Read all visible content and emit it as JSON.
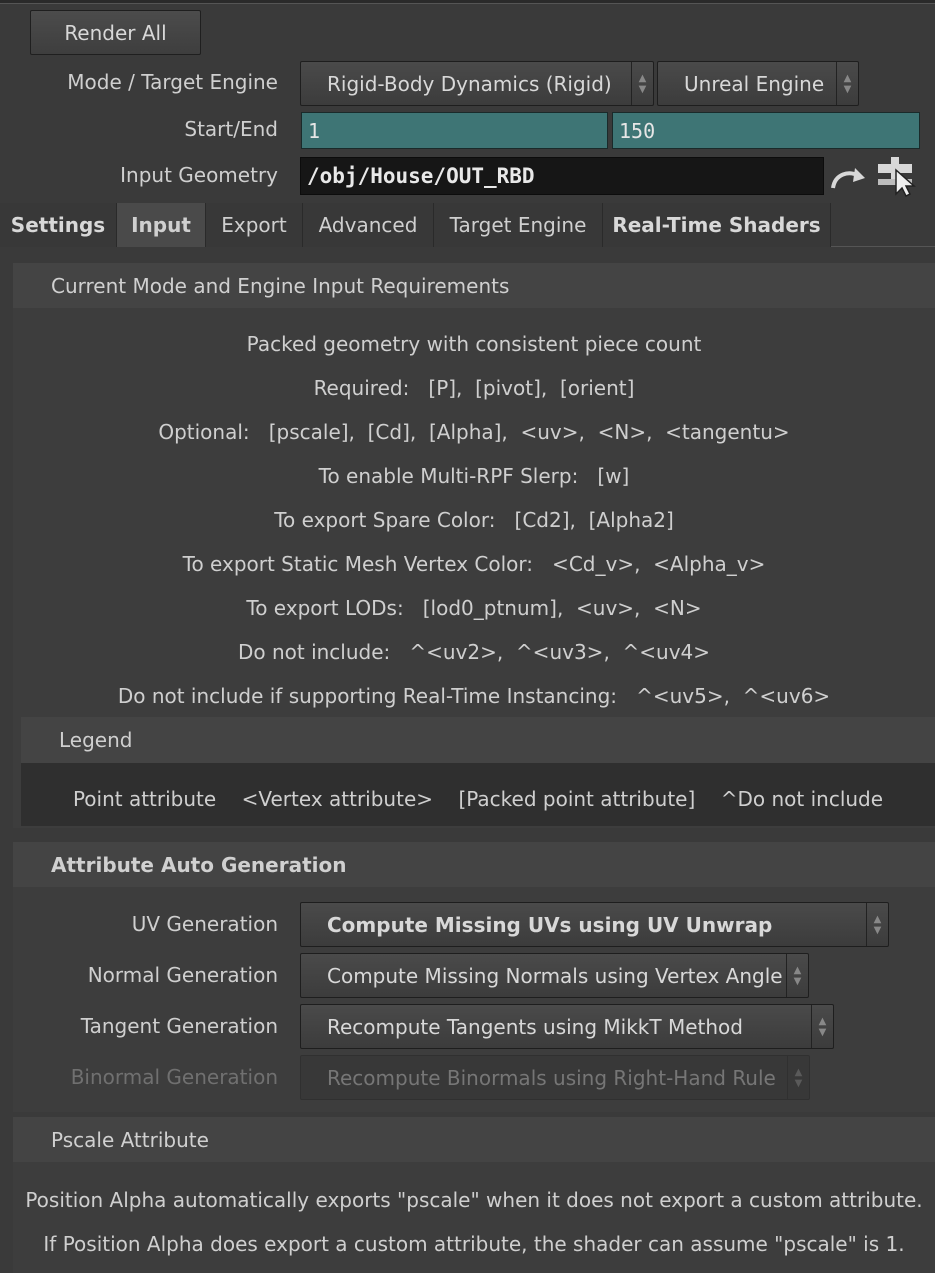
{
  "toolbar": {
    "render_all_label": "Render All"
  },
  "mode_row": {
    "label": "Mode / Target Engine",
    "mode_value": "Rigid-Body Dynamics (Rigid)",
    "engine_value": "Unreal Engine"
  },
  "range_row": {
    "label": "Start/End",
    "start": "1",
    "end": "150"
  },
  "geometry_row": {
    "label": "Input Geometry",
    "path": "/obj/House/OUT_RBD"
  },
  "tabs": [
    {
      "label": "Settings"
    },
    {
      "label": "Input"
    },
    {
      "label": "Export"
    },
    {
      "label": "Advanced"
    },
    {
      "label": "Target Engine"
    },
    {
      "label": "Real-Time Shaders"
    }
  ],
  "requirements": {
    "title": "Current Mode and Engine Input Requirements",
    "lines": [
      "Packed geometry with consistent piece count",
      "Required:   [P],  [pivot],  [orient]",
      "Optional:   [pscale],  [Cd],  [Alpha],  <uv>,  <N>,  <tangentu>",
      "To enable Multi-RPF Slerp:   [w]",
      "To export Spare Color:   [Cd2],  [Alpha2]",
      "To export Static Mesh Vertex Color:   <Cd_v>,  <Alpha_v>",
      "To export LODs:   [lod0_ptnum],  <uv>,  <N>",
      "Do not include:   ^<uv2>,  ^<uv3>,  ^<uv4>",
      "Do not include if supporting Real-Time Instancing:   ^<uv5>,  ^<uv6>"
    ]
  },
  "legend": {
    "title": "Legend",
    "text": "Point attribute    <Vertex attribute>    [Packed point attribute]    ^Do not include"
  },
  "auto_gen": {
    "title": "Attribute Auto Generation",
    "uv_label": "UV Generation",
    "uv_value": "Compute Missing UVs using UV Unwrap",
    "normal_label": "Normal Generation",
    "normal_value": "Compute Missing Normals using Vertex Angle",
    "tangent_label": "Tangent Generation",
    "tangent_value": "Recompute Tangents using MikkT Method",
    "binormal_label": "Binormal Generation",
    "binormal_value": "Recompute Binormals using Right-Hand Rule"
  },
  "pscale": {
    "title": "Pscale Attribute",
    "line1": "Position Alpha automatically exports \"pscale\" when it does not export a custom attribute.",
    "line2": "If Position Alpha does export a custom attribute, the shader can assume \"pscale\" is 1."
  },
  "colors": {
    "field_teal": "#3e7575",
    "background": "#3a3a3a",
    "header": "#444444"
  },
  "icons": [
    "jump-arrow-icon",
    "node-select-icon",
    "menu-arrows-icon"
  ]
}
